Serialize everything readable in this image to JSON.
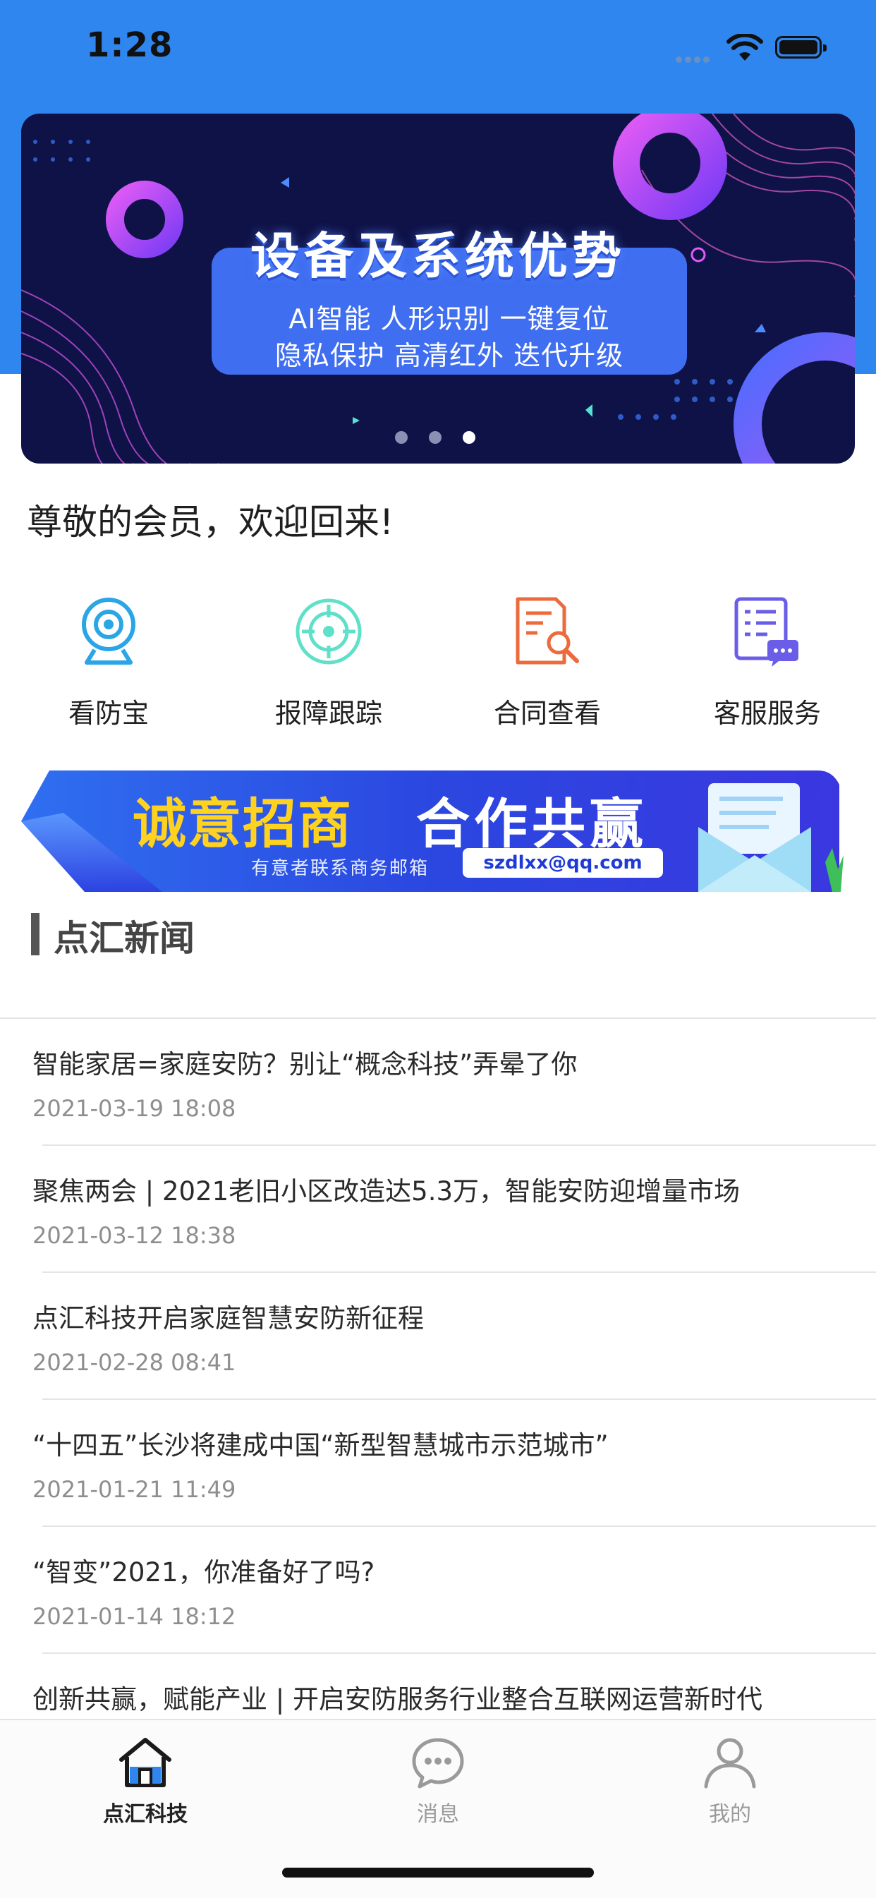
{
  "status_bar": {
    "time": "1:28"
  },
  "banner": {
    "title": "设备及系统优势",
    "line1": "AI智能  人形识别  一键复位",
    "line2": "隐私保护  高清红外  迭代升级",
    "slide_count": 3,
    "active_slide": 3
  },
  "welcome": "尊敬的会员，欢迎回来!",
  "quick_actions": [
    {
      "label": "看防宝",
      "icon": "camera-icon"
    },
    {
      "label": "报障跟踪",
      "icon": "target-icon"
    },
    {
      "label": "合同查看",
      "icon": "document-search-icon"
    },
    {
      "label": "客服服务",
      "icon": "chat-list-icon"
    }
  ],
  "promo": {
    "headline_yellow": "诚意招商",
    "headline_white": "合作共赢",
    "subtext": "有意者联系商务邮箱",
    "email": "szdlxx@qq.com"
  },
  "news_section": {
    "title": "点汇新闻"
  },
  "news": [
    {
      "title": "智能家居=家庭安防？别让“概念科技”弄晕了你",
      "date": "2021-03-19 18:08"
    },
    {
      "title": "聚焦两会 | 2021老旧小区改造达5.3万，智能安防迎增量市场",
      "date": "2021-03-12 18:38"
    },
    {
      "title": "点汇科技开启家庭智慧安防新征程",
      "date": "2021-02-28 08:41"
    },
    {
      "title": "“十四五”长沙将建成中国“新型智慧城市示范城市”",
      "date": "2021-01-21 11:49"
    },
    {
      "title": "“智变”2021，你准备好了吗?",
      "date": "2021-01-14 18:12"
    },
    {
      "title": "创新共赢，赋能产业 | 开启安防服务行业整合互联网运营新时代",
      "date": ""
    }
  ],
  "tabbar": [
    {
      "label": "点汇科技",
      "icon": "home-icon",
      "active": true
    },
    {
      "label": "消息",
      "icon": "message-icon",
      "active": false
    },
    {
      "label": "我的",
      "icon": "user-icon",
      "active": false
    }
  ],
  "colors": {
    "header_blue": "#2f86ee",
    "banner_navy": "#0f1247",
    "promo_blue": "#2a4fe6",
    "accent_yellow": "#ffd21f"
  }
}
